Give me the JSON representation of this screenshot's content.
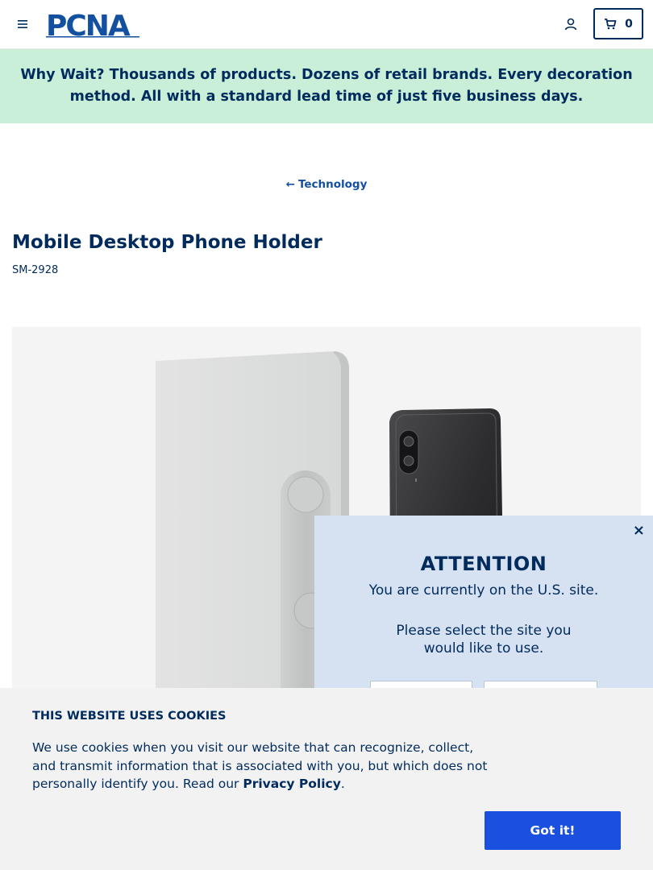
{
  "header": {
    "logo_text": "PCNA",
    "cart_count": "0",
    "icons": [
      "menu-icon",
      "account-icon",
      "cart-icon"
    ]
  },
  "promo": {
    "text": "Why Wait? Thousands of products. Dozens of retail brands. Every decoration method. All with a standard lead time of just five business days."
  },
  "breadcrumb": {
    "back_label": "Technology"
  },
  "product": {
    "title": "Mobile Desktop Phone Holder",
    "sku": "SM-2928"
  },
  "site_modal": {
    "close_label": "×",
    "title": "ATTENTION",
    "line1": "You are currently on the U.S. site.",
    "line2": "Please select the site you would like to use."
  },
  "cookie_banner": {
    "title": "THIS WEBSITE USES COOKIES",
    "text": "We use cookies when you visit our website that can recognize, collect, and transmit information that is associated with you, but which does not personally identify you. Read our ",
    "link_label": "Privacy Policy",
    "after_link": ".",
    "button_label": "Got it!"
  },
  "colors": {
    "brand_navy": "#002b5c",
    "promo_bg": "#c9efd9",
    "modal_bg": "#d6e1f2",
    "button_blue": "#1b4fe0"
  }
}
